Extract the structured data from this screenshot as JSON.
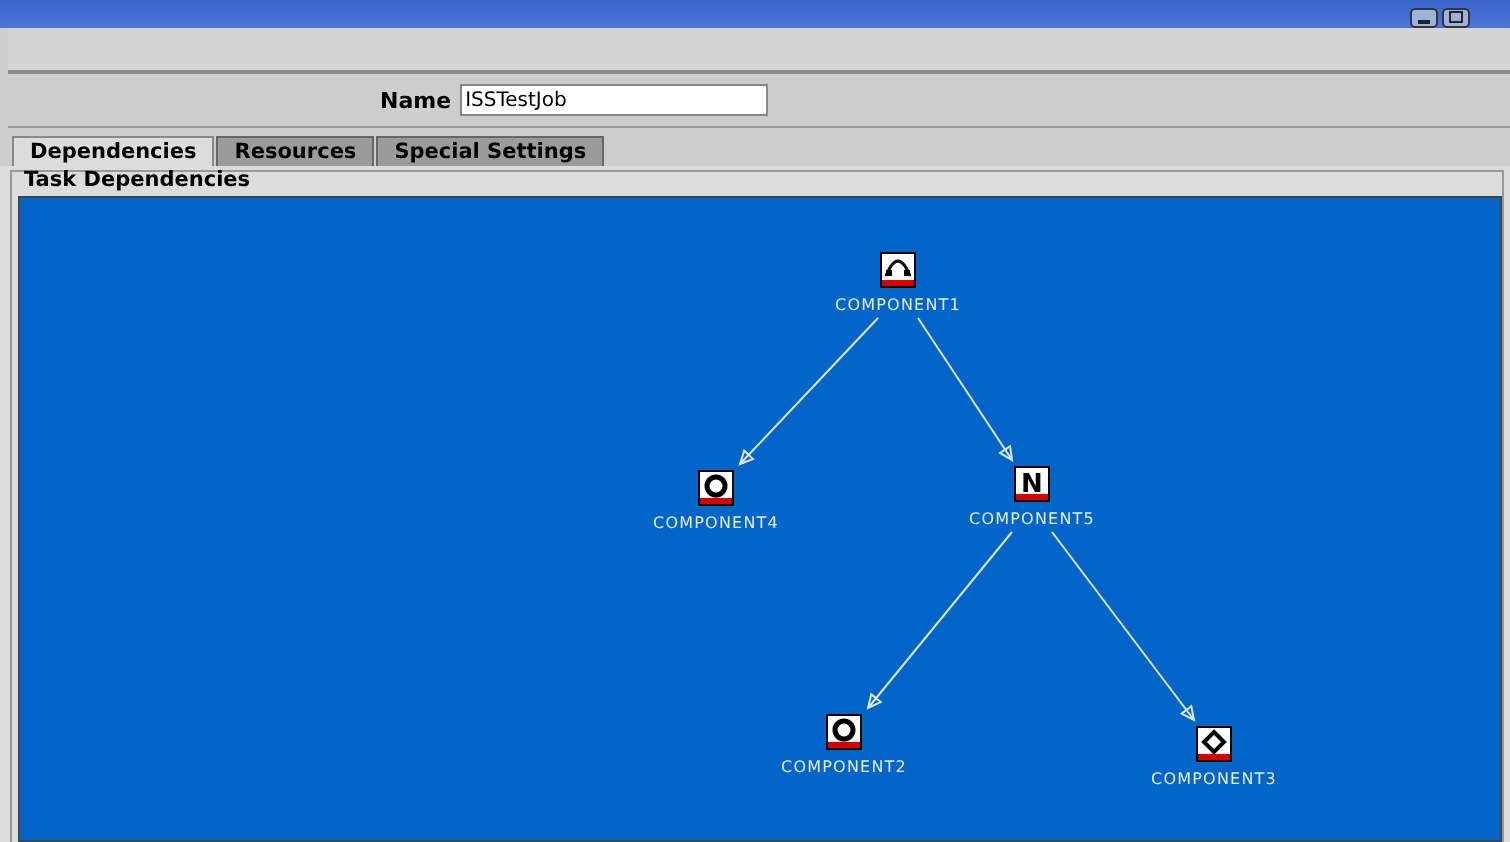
{
  "form": {
    "name_label": "Name",
    "name_value": "ISSTestJob"
  },
  "tabs": [
    {
      "label": "Dependencies",
      "selected": true
    },
    {
      "label": "Resources",
      "selected": false
    },
    {
      "label": "Special Settings",
      "selected": false
    }
  ],
  "group": {
    "title": "Task Dependencies"
  },
  "nodes": [
    {
      "label": "COMPONENT1",
      "kind": "arc",
      "children": [
        {
          "label": "COMPONENT4",
          "kind": "circle"
        },
        {
          "label": "COMPONENT5",
          "kind": "letter",
          "glyph": "N",
          "children": [
            {
              "label": "COMPONENT2",
              "kind": "circle"
            },
            {
              "label": "COMPONENT3",
              "kind": "diamond"
            }
          ]
        }
      ]
    }
  ]
}
